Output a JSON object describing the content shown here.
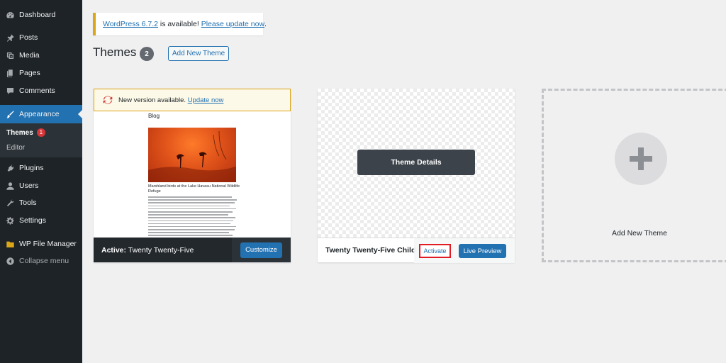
{
  "sidebar": {
    "items": [
      {
        "label": "Dashboard",
        "icon": "dashboard-icon"
      },
      {
        "label": "Posts",
        "icon": "pin-icon"
      },
      {
        "label": "Media",
        "icon": "media-icon"
      },
      {
        "label": "Pages",
        "icon": "pages-icon"
      },
      {
        "label": "Comments",
        "icon": "comment-icon"
      },
      {
        "label": "Appearance",
        "icon": "brush-icon"
      },
      {
        "label": "Plugins",
        "icon": "plug-icon"
      },
      {
        "label": "Users",
        "icon": "users-icon"
      },
      {
        "label": "Tools",
        "icon": "wrench-icon"
      },
      {
        "label": "Settings",
        "icon": "settings-icon"
      },
      {
        "label": "WP File Manager",
        "icon": "folder-icon"
      },
      {
        "label": "Collapse menu",
        "icon": "collapse-icon"
      }
    ],
    "submenu": {
      "themes_label": "Themes",
      "themes_badge": "1",
      "editor_label": "Editor"
    },
    "active_item": "Appearance"
  },
  "notice": {
    "version_link": "WordPress 6.7.2",
    "middle_text": " is available! ",
    "update_link": "Please update now",
    "end_text": "."
  },
  "header": {
    "title": "Themes",
    "count": "2",
    "add_new_label": "Add New Theme"
  },
  "themes": {
    "active": {
      "notice_text": "New version available. ",
      "notice_link": "Update now",
      "screenshot": {
        "blog_label": "Blog",
        "post_title": "Marshland birds at the Lake Havasu National Wildlife Refuge"
      },
      "active_prefix": "Active:",
      "name": " Twenty Twenty-Five",
      "customize_label": "Customize"
    },
    "child": {
      "details_label": "Theme Details",
      "name": "Twenty Twenty-Five Child",
      "activate_label": "Activate",
      "live_preview_label": "Live Preview"
    },
    "add_new_tile_label": "Add New Theme"
  },
  "colors": {
    "sidebar_bg": "#1d2327",
    "accent": "#2271b1",
    "notice_border": "#dba617",
    "badge": "#d63638",
    "highlight": "#e01b24"
  }
}
